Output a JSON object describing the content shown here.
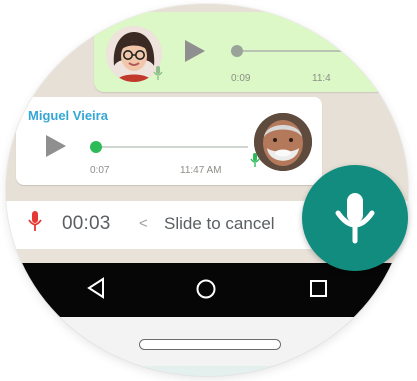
{
  "messages": {
    "outgoing": {
      "duration": "0:09",
      "time": "11:4"
    },
    "incoming": {
      "sender": "Miguel Vieira",
      "duration": "0:07",
      "time": "11:47 AM"
    }
  },
  "recording": {
    "elapsed": "00:03",
    "cancel_chevron": "<",
    "cancel_hint": "Slide to cancel"
  },
  "colors": {
    "accent": "#128c7e",
    "outgoing_bubble": "#dcf8c6",
    "sender_name": "#35a7d6",
    "record_red": "#e53935",
    "progress_green": "#2dbb5a"
  },
  "icons": {
    "record": "mic-icon",
    "send_voice": "mic-icon",
    "play": "play-icon",
    "nav_back": "triangle-back-icon",
    "nav_home": "circle-home-icon",
    "nav_recents": "square-recents-icon"
  }
}
